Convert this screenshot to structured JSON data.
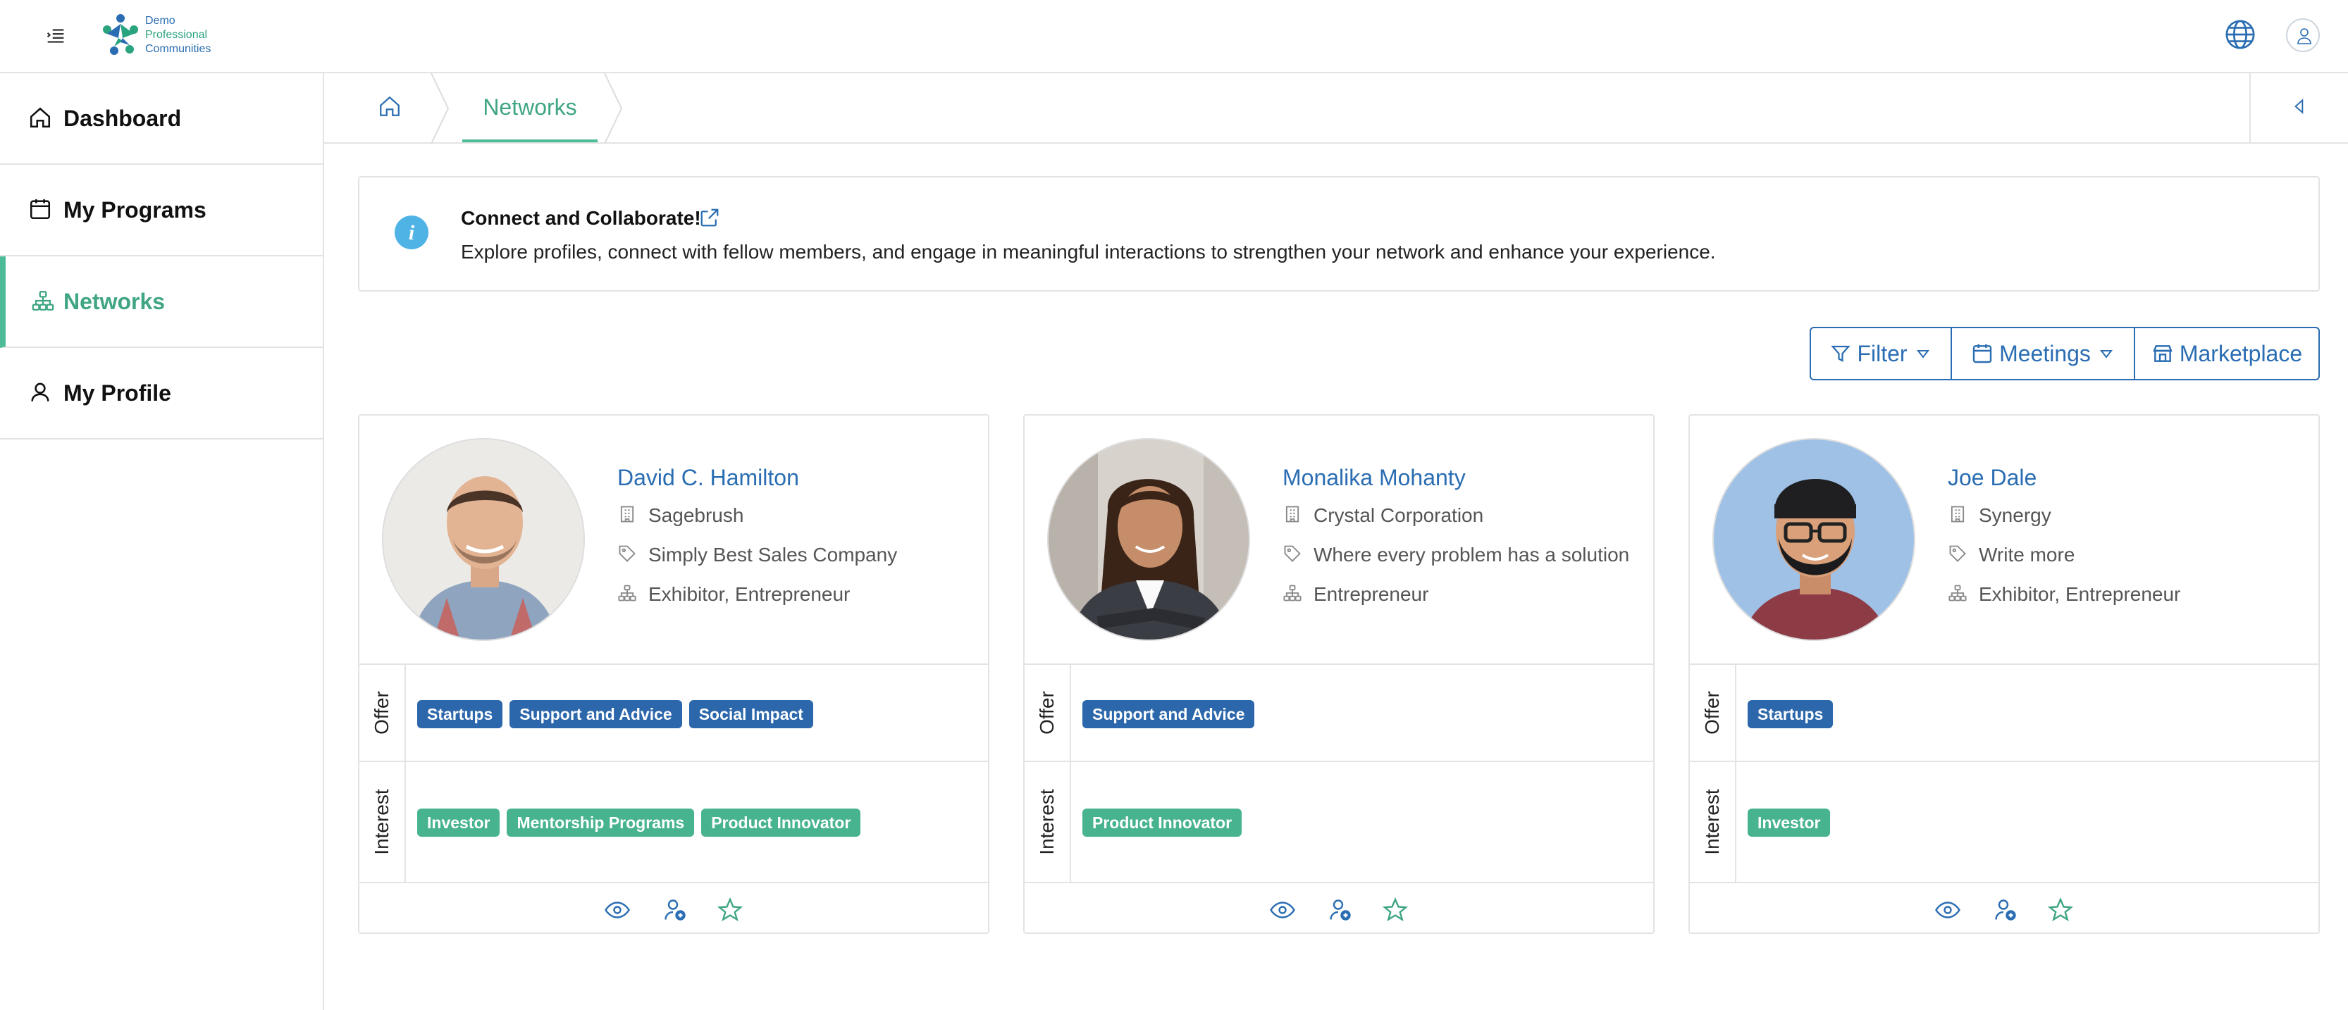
{
  "header": {
    "logo_lines": [
      "Demo",
      "Professional",
      "Communities"
    ],
    "menu_icon": "menu-collapse-icon",
    "language_icon": "globe-icon",
    "user_icon": "user-icon"
  },
  "sidebar": {
    "items": [
      {
        "label": "Dashboard",
        "icon": "home-icon",
        "active": false
      },
      {
        "label": "My Programs",
        "icon": "calendar-icon",
        "active": false
      },
      {
        "label": "Networks",
        "icon": "network-icon",
        "active": true
      },
      {
        "label": "My Profile",
        "icon": "user-icon",
        "active": false
      }
    ]
  },
  "breadcrumb": {
    "home_icon": "home-icon",
    "current": "Networks",
    "collapse_icon": "caret-left-icon"
  },
  "banner": {
    "title": "Connect and Collaborate!",
    "description": "Explore profiles, connect with fellow members, and engage in meaningful interactions to strengthen your network and enhance your experience."
  },
  "toolbar": {
    "filter_label": "Filter",
    "meetings_label": "Meetings",
    "marketplace_label": "Marketplace"
  },
  "colors": {
    "primary_blue": "#2a6db2",
    "accent_green": "#4dbb98",
    "offer_tag": "#2c67ab",
    "interest_tag": "#48b48f"
  },
  "section_labels": {
    "offer": "Offer",
    "interest": "Interest"
  },
  "profiles": [
    {
      "name": "David C. Hamilton",
      "company": "Sagebrush",
      "tagline": "Simply Best Sales Company",
      "roles": "Exhibitor, Entrepreneur",
      "offer": [
        "Startups",
        "Support and Advice",
        "Social Impact"
      ],
      "interest": [
        "Investor",
        "Mentorship Programs",
        "Product Innovator"
      ]
    },
    {
      "name": "Monalika Mohanty",
      "company": "Crystal Corporation",
      "tagline": "Where every problem has a solution",
      "roles": "Entrepreneur",
      "offer": [
        "Support and Advice"
      ],
      "interest": [
        "Product Innovator"
      ]
    },
    {
      "name": "Joe Dale",
      "company": "Synergy",
      "tagline": "Write more",
      "roles": "Exhibitor, Entrepreneur",
      "offer": [
        "Startups"
      ],
      "interest": [
        "Investor"
      ]
    }
  ]
}
